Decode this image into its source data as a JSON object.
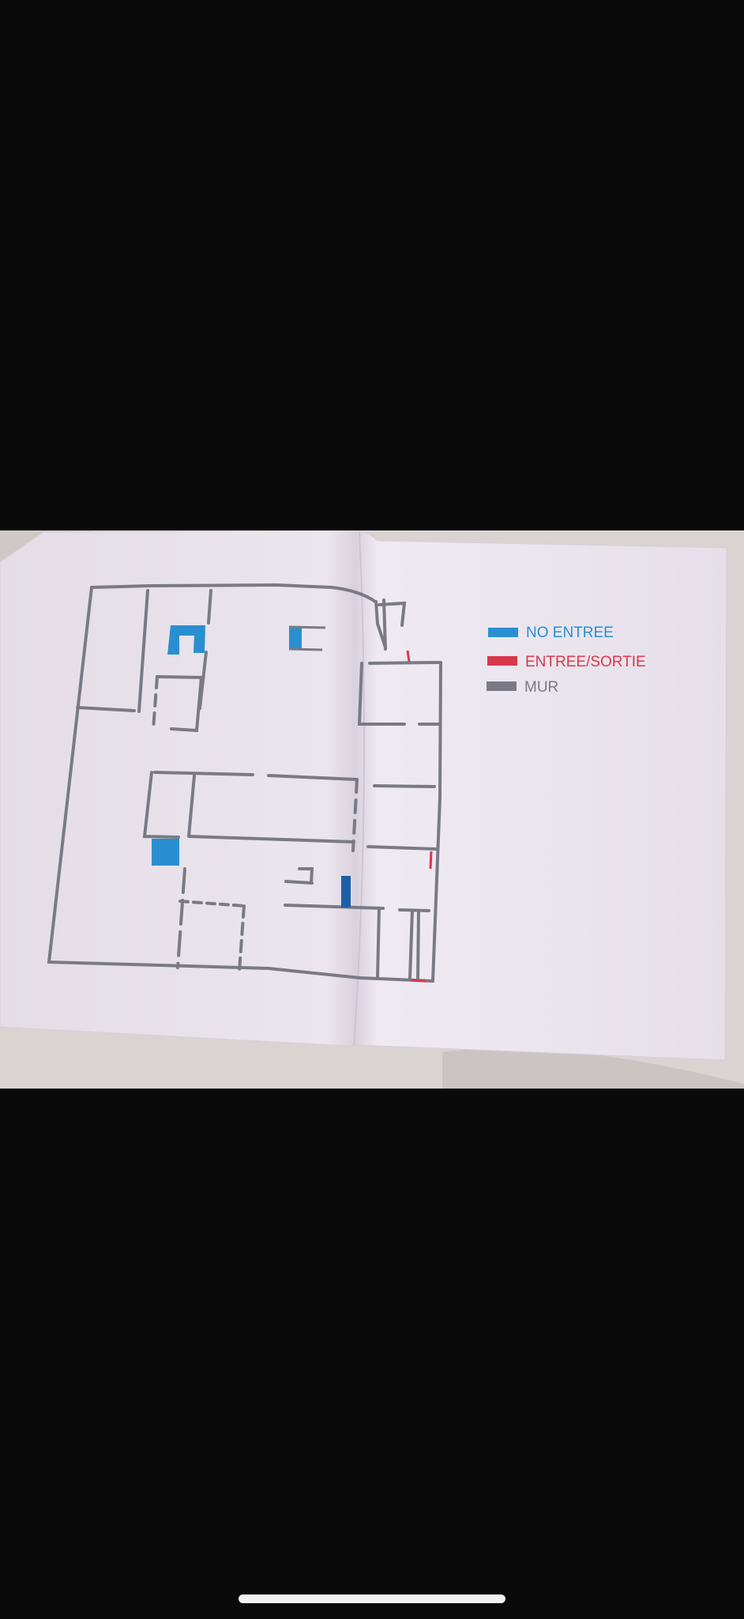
{
  "legend": {
    "items": [
      {
        "label": "NO ENTREE",
        "color": "#2a8fd0"
      },
      {
        "label": "ENTREE/SORTIE",
        "color": "#d8384a"
      },
      {
        "label": "MUR",
        "color": "#7a7a84"
      }
    ]
  },
  "colors": {
    "background": "#0a0a0b",
    "paper": "#ebe4ee",
    "wall": "#7a7a84",
    "no_entry": "#2a8fd0",
    "entry_exit": "#d8384a",
    "bedsheet": "#d9d3d2",
    "home_indicator": "#f2f2f2"
  }
}
